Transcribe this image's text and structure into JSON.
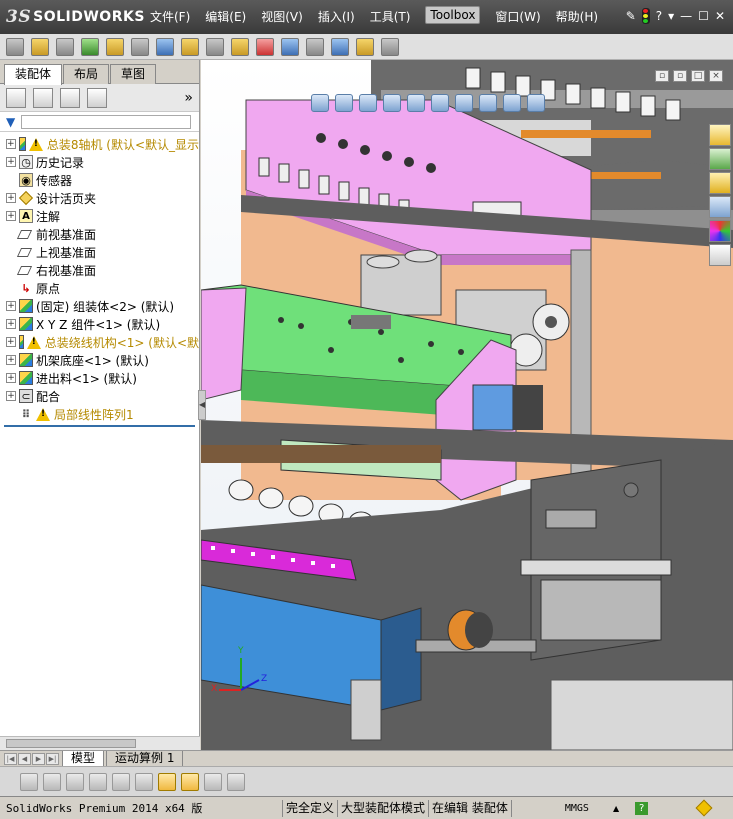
{
  "app": {
    "logo_text": "SOLIDWORKS",
    "logo_prefix": "3S"
  },
  "menu": {
    "items": [
      "文件(F)",
      "编辑(E)",
      "视图(V)",
      "插入(I)",
      "工具(T)",
      "Toolbox",
      "窗口(W)",
      "帮助(H)"
    ],
    "right": [
      "?",
      "▾",
      "—",
      "☐",
      "✕"
    ]
  },
  "feature_manager": {
    "tabs": [
      "装配体",
      "布局",
      "草图"
    ],
    "more": "»",
    "tree": [
      {
        "label": "总装8轴机   (默认<默认_显示",
        "icon": "assembly-icon",
        "warn": true,
        "expand": "+",
        "color": "yellow"
      },
      {
        "label": "历史记录",
        "icon": "history-icon",
        "warn": false,
        "expand": "+",
        "color": "black"
      },
      {
        "label": "传感器",
        "icon": "sensor-icon",
        "warn": false,
        "expand": "",
        "color": "black"
      },
      {
        "label": "设计活页夹",
        "icon": "binder-icon",
        "warn": false,
        "expand": "+",
        "color": "black"
      },
      {
        "label": "注解",
        "icon": "annotation-icon",
        "warn": false,
        "expand": "+",
        "color": "black"
      },
      {
        "label": "前视基准面",
        "icon": "plane-icon",
        "warn": false,
        "expand": "",
        "color": "black"
      },
      {
        "label": "上视基准面",
        "icon": "plane-icon",
        "warn": false,
        "expand": "",
        "color": "black"
      },
      {
        "label": "右视基准面",
        "icon": "plane-icon",
        "warn": false,
        "expand": "",
        "color": "black"
      },
      {
        "label": "原点",
        "icon": "origin-icon",
        "warn": false,
        "expand": "",
        "color": "black"
      },
      {
        "label": "(固定) 组装体<2> (默认)",
        "icon": "assembly-icon",
        "warn": false,
        "expand": "+",
        "color": "black"
      },
      {
        "label": "X Y Z 组件<1> (默认)",
        "icon": "assembly-icon",
        "warn": false,
        "expand": "+",
        "color": "black"
      },
      {
        "label": "总装绕线机构<1> (默认<默",
        "icon": "assembly-icon",
        "warn": true,
        "expand": "+",
        "color": "yellow"
      },
      {
        "label": "机架底座<1> (默认)",
        "icon": "assembly-icon",
        "warn": false,
        "expand": "+",
        "color": "black"
      },
      {
        "label": "进出料<1> (默认)",
        "icon": "assembly-icon",
        "warn": false,
        "expand": "+",
        "color": "black"
      },
      {
        "label": "配合",
        "icon": "mates-icon",
        "warn": false,
        "expand": "+",
        "color": "black"
      },
      {
        "label": "局部线性阵列1",
        "icon": "pattern-icon",
        "warn": true,
        "expand": "",
        "color": "yellow"
      }
    ]
  },
  "bottom_tabs": [
    "模型",
    "运动算例 1"
  ],
  "triad": {
    "x": "X",
    "y": "Y",
    "z": "Z"
  },
  "status": {
    "app_version": "SolidWorks Premium 2014 x64 版",
    "defined": "完全定义",
    "mode": "大型装配体模式",
    "editing": "在编辑 装配体",
    "units": "MMGS",
    "units_arrow": "▲",
    "help": "?"
  },
  "colors": {
    "frame_gray": "#5e5e5e",
    "pink_panel": "#f0a8f0",
    "green_panel": "#6fe07a",
    "peach_wall": "#f1b98f",
    "blue_block": "#3e8fd8",
    "magenta_strip": "#d92ad9"
  }
}
